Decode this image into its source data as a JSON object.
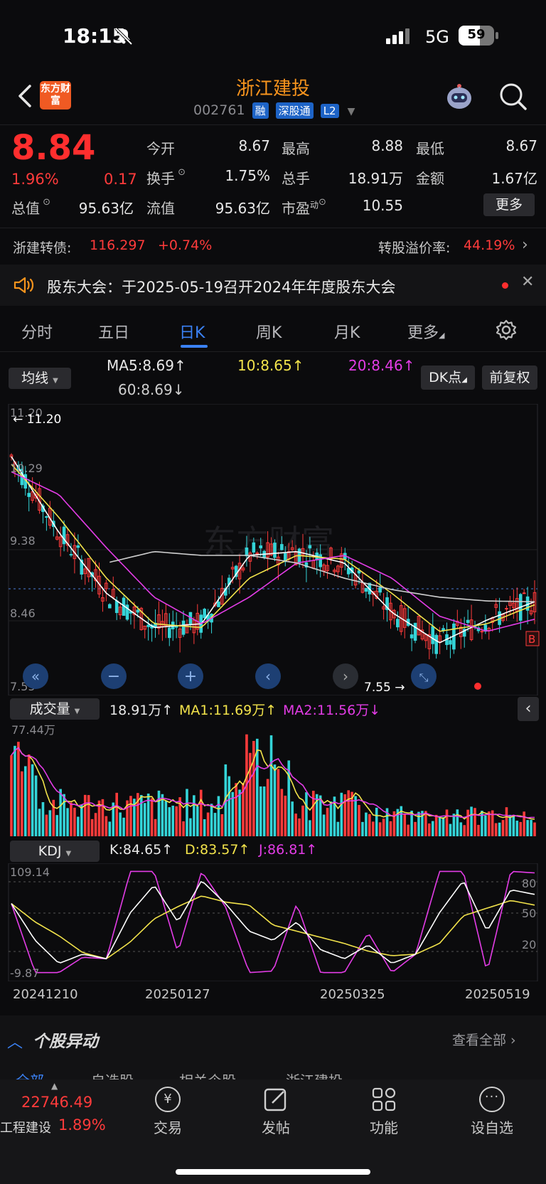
{
  "status_bar": {
    "time": "18:15",
    "network": "5G",
    "battery": "59"
  },
  "header": {
    "logo_text": "东方财富",
    "title": "浙江建投",
    "code": "002761",
    "tags": [
      "融",
      "深股通",
      "L2"
    ]
  },
  "quote": {
    "price": "8.84",
    "change_pct": "1.96%",
    "change_amt": "0.17",
    "open_label": "今开",
    "open": "8.67",
    "high_label": "最高",
    "high": "8.88",
    "low_label": "最低",
    "low": "8.67",
    "turnover_label": "换手",
    "turnover": "1.75%",
    "volume_label": "总手",
    "volume": "18.91万",
    "amount_label": "金额",
    "amount": "1.67亿",
    "mktcap_label": "总值",
    "mktcap": "95.63亿",
    "float_label": "流值",
    "float_cap": "95.63亿",
    "pe_label": "市盈",
    "pe_sup": "动",
    "pe": "10.55",
    "more_button": "更多"
  },
  "bond": {
    "label": "浙建转债:",
    "price": "116.297",
    "change": "+0.74%",
    "premium_label": "转股溢价率:",
    "premium": "44.19%"
  },
  "notice": {
    "text": "股东大会：于2025-05-19召开2024年年度股东大会"
  },
  "tabs": [
    "分时",
    "五日",
    "日K",
    "周K",
    "月K",
    "更多"
  ],
  "active_tab": "日K",
  "ma_bar": {
    "selector": "均线",
    "ma5": "MA5:8.69",
    "ma10": "10:8.65",
    "ma20": "20:8.46",
    "ma60": "60:8.69",
    "dk_button": "DK点",
    "adjust_button": "前复权"
  },
  "price_axis": {
    "top": "11.20",
    "upper": "10.29",
    "mid": "9.38",
    "lower": "8.46",
    "bottom": "7.55"
  },
  "price_marks": {
    "high_mark": "11.20",
    "low_mark": "7.55",
    "b_mark": "B"
  },
  "volume_bar": {
    "selector": "成交量",
    "vol": "18.91万",
    "ma1": "MA1:11.69万",
    "ma2": "MA2:11.56万",
    "axis_max": "77.44万"
  },
  "kdj_bar": {
    "selector": "KDJ",
    "k": "K:84.65",
    "d": "D:83.57",
    "j": "J:86.81",
    "axis_max": "109.14",
    "axis_min": "-9.87",
    "levels": [
      "80",
      "50",
      "20"
    ]
  },
  "dates": [
    "20241210",
    "20250127",
    "20250325",
    "20250519"
  ],
  "stock_alert": {
    "title": "个股异动",
    "view_all": "查看全部"
  },
  "bottom_tabs_partial": [
    "全部",
    "自选股",
    "相关个股",
    "浙江建投"
  ],
  "index_ticker": {
    "value": "22746.49",
    "name": "工程建设",
    "pct": "1.89%"
  },
  "bottom_nav": [
    "交易",
    "发帖",
    "功能",
    "设自选"
  ],
  "colors": {
    "up": "#ff3b3b",
    "down": "#34d4d8",
    "ma5": "#ffffff",
    "ma10": "#f2e34b",
    "ma20": "#e33ce6",
    "ma60": "#cfcfcf",
    "accent": "#3b82f6",
    "title": "#f7941d"
  },
  "chart_data": [
    {
      "type": "line",
      "title": "日K",
      "x": [
        "20241210",
        "20250127",
        "20250325",
        "20250519"
      ],
      "ylim": [
        7.55,
        11.2
      ],
      "series": [
        {
          "name": "MA5",
          "values": [
            10.6,
            9.6,
            8.8,
            8.35,
            8.4,
            9.3,
            9.35,
            9.2,
            8.55,
            8.15,
            8.45,
            8.69
          ]
        },
        {
          "name": "10",
          "values": [
            10.5,
            9.8,
            9.0,
            8.4,
            8.35,
            9.0,
            9.3,
            9.25,
            8.8,
            8.3,
            8.4,
            8.65
          ]
        },
        {
          "name": "20",
          "values": [
            10.4,
            10.1,
            9.4,
            8.75,
            8.4,
            8.75,
            9.2,
            9.3,
            9.0,
            8.5,
            8.3,
            8.46
          ]
        },
        {
          "name": "60",
          "values": [
            null,
            null,
            9.2,
            9.35,
            9.3,
            9.3,
            9.2,
            9.0,
            8.85,
            8.75,
            8.7,
            8.69
          ]
        }
      ]
    },
    {
      "type": "bar",
      "title": "成交量",
      "ylim": [
        0,
        77.44
      ],
      "last": 18.91,
      "ma1": 11.69,
      "ma2": 11.56
    },
    {
      "type": "line",
      "title": "KDJ",
      "ylim": [
        -9.87,
        109.14
      ],
      "last": {
        "K": 84.65,
        "D": 83.57,
        "J": 86.81
      }
    }
  ]
}
